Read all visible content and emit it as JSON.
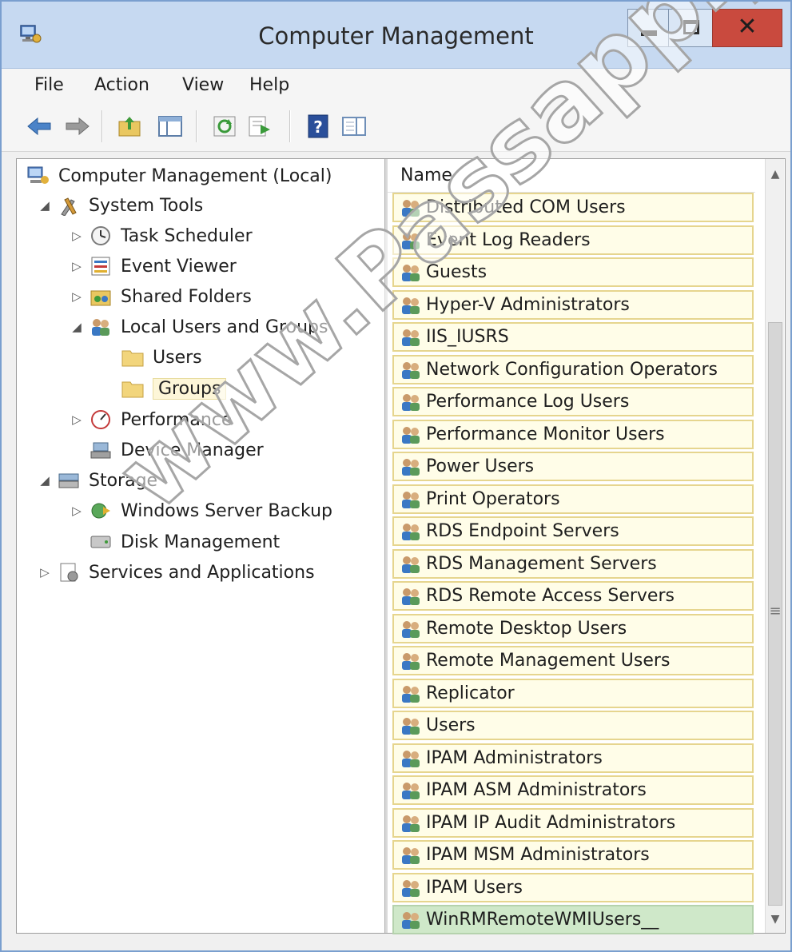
{
  "window": {
    "title": "Computer Management",
    "icon": "computer-management-icon",
    "controls": {
      "minimize": "minimize-icon",
      "maximize": "maximize-icon",
      "close": "✕"
    },
    "colors": {
      "titlebar": "#c6d9f1",
      "close_button": "#c94a3e",
      "selection_border": "#e6d58e",
      "selection_fill": "#fffde8",
      "highlight_fill": "#cfe8c9"
    }
  },
  "menu": [
    {
      "label": "File"
    },
    {
      "label": "Action"
    },
    {
      "label": "View"
    },
    {
      "label": "Help"
    }
  ],
  "toolbar": {
    "buttons": [
      "back-arrow-icon",
      "forward-arrow-icon",
      "up-folder-icon",
      "show-hide-tree-icon",
      "refresh-icon",
      "export-list-icon",
      "help-icon",
      "show-hide-action-pane-icon"
    ]
  },
  "tree": {
    "root": "Computer Management (Local)",
    "items": [
      {
        "label": "System Tools",
        "state": "expanded",
        "icon": "tools-icon"
      },
      {
        "label": "Task Scheduler",
        "state": "collapsed",
        "icon": "clock-icon"
      },
      {
        "label": "Event Viewer",
        "state": "collapsed",
        "icon": "event-viewer-icon"
      },
      {
        "label": "Shared Folders",
        "state": "collapsed",
        "icon": "shared-folder-icon"
      },
      {
        "label": "Local Users and Groups",
        "state": "expanded",
        "icon": "users-group-icon"
      },
      {
        "label": "Users",
        "state": "leaf",
        "icon": "folder-icon"
      },
      {
        "label": "Groups",
        "state": "selected",
        "icon": "folder-icon"
      },
      {
        "label": "Performance",
        "state": "collapsed",
        "icon": "performance-icon"
      },
      {
        "label": "Device Manager",
        "state": "leaf",
        "icon": "device-manager-icon"
      },
      {
        "label": "Storage",
        "state": "expanded",
        "icon": "storage-icon"
      },
      {
        "label": "Windows Server Backup",
        "state": "collapsed",
        "icon": "backup-icon"
      },
      {
        "label": "Disk Management",
        "state": "leaf",
        "icon": "disk-icon"
      },
      {
        "label": "Services and Applications",
        "state": "collapsed",
        "icon": "services-icon"
      }
    ]
  },
  "list": {
    "column_header": "Name",
    "rows": [
      "Distributed COM Users",
      "Event Log Readers",
      "Guests",
      "Hyper-V Administrators",
      "IIS_IUSRS",
      "Network Configuration Operators",
      "Performance Log Users",
      "Performance Monitor Users",
      "Power Users",
      "Print Operators",
      "RDS Endpoint Servers",
      "RDS Management Servers",
      "RDS Remote Access Servers",
      "Remote Desktop Users",
      "Remote Management Users",
      "Replicator",
      "Users",
      "IPAM Administrators",
      "IPAM ASM Administrators",
      "IPAM IP Audit Administrators",
      "IPAM MSM Administrators",
      "IPAM Users",
      "WinRMRemoteWMIUsers__"
    ],
    "highlighted_row": "WinRMRemoteWMIUsers__"
  },
  "scrollbar": {
    "up": "▲",
    "down": "▼",
    "grip": "≡"
  },
  "watermark": "www.Passapply.com"
}
